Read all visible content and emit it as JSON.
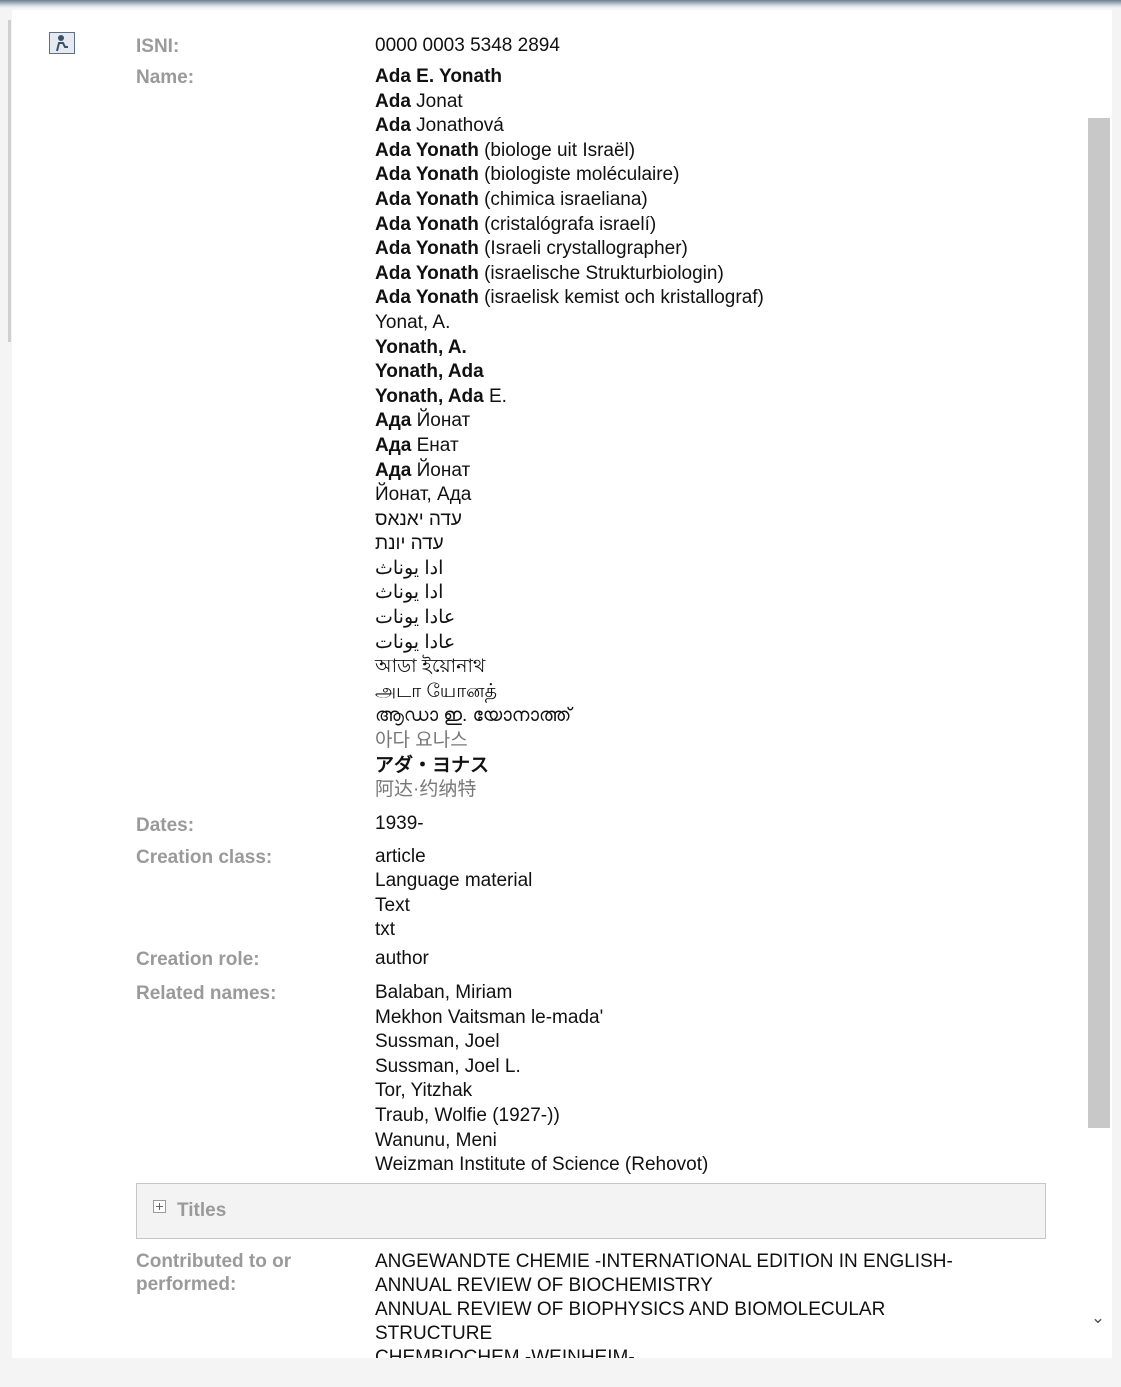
{
  "record": {
    "isni_label": "ISNI:",
    "isni_value": "0000 0003 5348 2894",
    "name_label": "Name:",
    "names": [
      {
        "bold": "Ada E. Yonath",
        "rest": ""
      },
      {
        "bold": "Ada",
        "rest": " Jonat"
      },
      {
        "bold": "Ada",
        "rest": " Jonathová"
      },
      {
        "bold": "Ada Yonath",
        "rest": " (biologe uit Israël)"
      },
      {
        "bold": "Ada Yonath",
        "rest": " (biologiste moléculaire)"
      },
      {
        "bold": "Ada Yonath",
        "rest": " (chimica israeliana)"
      },
      {
        "bold": "Ada Yonath",
        "rest": " (cristalógrafa israelí)"
      },
      {
        "bold": "Ada Yonath",
        "rest": " (Israeli crystallographer)"
      },
      {
        "bold": "Ada Yonath",
        "rest": " (israelische Strukturbiologin)"
      },
      {
        "bold": "Ada Yonath",
        "rest": " (israelisk kemist och kristallograf)"
      },
      {
        "bold": "",
        "rest": "Yonat, A."
      },
      {
        "bold": "Yonath, A.",
        "rest": ""
      },
      {
        "bold": "Yonath, Ada",
        "rest": ""
      },
      {
        "bold": "Yonath, Ada",
        "rest": " E."
      },
      {
        "bold": "Ада",
        "rest": " Йонат"
      },
      {
        "bold": "Ада",
        "rest": " Енат"
      },
      {
        "bold": "Ада",
        "rest": " Йонат"
      },
      {
        "bold": "",
        "rest": "Йонат, Ада"
      },
      {
        "bold": "",
        "rest": "עדה יאנאס"
      },
      {
        "bold": "",
        "rest": "עדה יונת"
      },
      {
        "bold": "",
        "rest": "ادا يوناث"
      },
      {
        "bold": "",
        "rest": "ادا يوناث"
      },
      {
        "bold": "",
        "rest": "عادا يونات"
      },
      {
        "bold": "",
        "rest": "عادا يونات"
      },
      {
        "bold": "",
        "rest": "আডা ইয়োনাথ"
      },
      {
        "bold": "",
        "rest": "அடா யோனத்"
      },
      {
        "bold": "",
        "rest": "ആഡാ ഇ. യോനാത്ത്"
      },
      {
        "bold": "",
        "rest": "아다 요나스",
        "faint": true
      },
      {
        "bold": "アダ・ヨナス",
        "rest": ""
      },
      {
        "bold": "",
        "rest": "阿达·约纳特",
        "faint": true
      }
    ],
    "dates_label": "Dates:",
    "dates_value": "1939-",
    "creation_class_label": "Creation class:",
    "creation_class": [
      "article",
      "Language material",
      "Text",
      "txt"
    ],
    "creation_role_label": "Creation role:",
    "creation_role": [
      "author"
    ],
    "related_label": "Related names:",
    "related": [
      "Balaban, Miriam",
      "Mekhon Vaitsman le-mada'",
      "Sussman, Joel",
      "Sussman, Joel L.",
      "Tor, Yitzhak",
      "Traub, Wolfie (1927-))",
      "Wanunu, Meni",
      "Weizman Institute of Science (Rehovot)"
    ],
    "titles_label": "Titles",
    "contrib_label_line1": "Contributed to or",
    "contrib_label_line2": "performed:",
    "contributed": [
      "ANGEWANDTE CHEMIE -INTERNATIONAL EDITION IN ENGLISH-",
      "ANNUAL REVIEW OF BIOCHEMISTRY",
      "ANNUAL REVIEW OF BIOPHYSICS AND BIOMOLECULAR",
      "STRUCTURE",
      "CHEMBIOCHEM -WEINHEIM-"
    ]
  },
  "icons": {
    "person": "person-icon",
    "titles_toggle": "expand-plus-icon",
    "scroll_down": "chevron-down-icon"
  },
  "scroll_down_glyph": "⌄",
  "colors": {
    "label": "#9a9a9a",
    "text": "#111111",
    "scroll_thumb": "#c8c8c8"
  }
}
